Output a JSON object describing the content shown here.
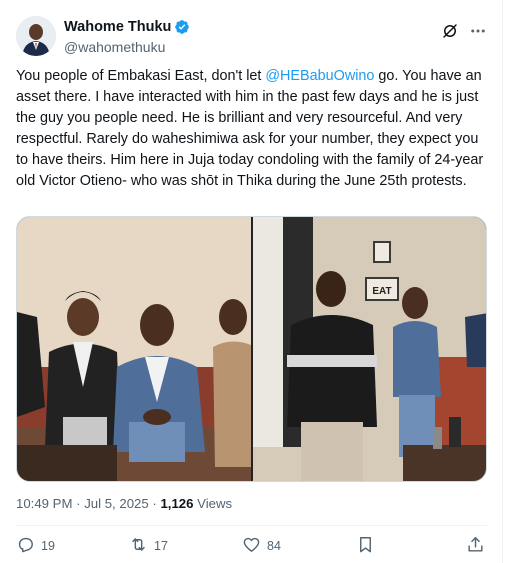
{
  "author": {
    "display_name": "Wahome Thuku",
    "handle": "@wahomethuku",
    "verified_color": "#1d9bf0"
  },
  "tweet": {
    "text_before": "You people of Embakasi East, don't let ",
    "mention": "@HEBabuOwino",
    "text_after": " go. You have an asset there. I have interacted with him in the past few days and he is just the guy you people need. He is brilliant and very resourceful. And very respectful. Rarely do waheshimiwa ask for your number, they expect you to have theirs. Him here in Juja today condoling with the family of 24-year old Victor Otieno- who was shōt in Thika during the June 25th protests."
  },
  "meta": {
    "time": "10:49 PM",
    "separator1": " · ",
    "date": "Jul 5, 2025",
    "separator2": " · ",
    "views_count": "1,126",
    "views_label": " Views"
  },
  "actions": {
    "replies": "19",
    "reposts": "17",
    "likes": "84"
  },
  "icons": [
    "grok-icon",
    "more-icon",
    "reply-icon",
    "repost-icon",
    "like-icon",
    "bookmark-icon",
    "share-icon",
    "verified-badge-icon"
  ],
  "colors": {
    "accent": "#1d9bf0",
    "secondary_text": "#536471",
    "primary_text": "#0f1419"
  }
}
